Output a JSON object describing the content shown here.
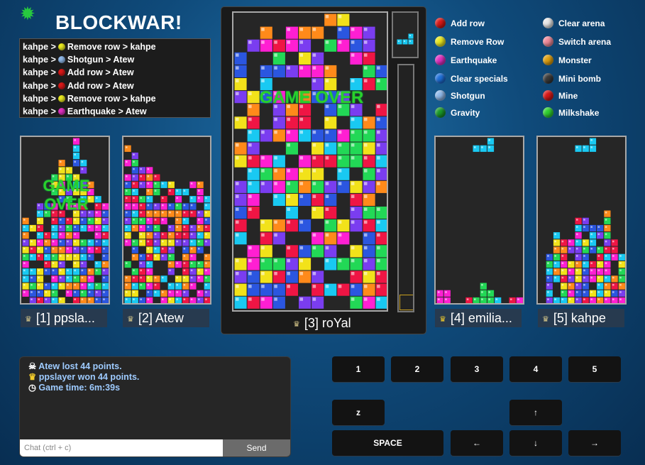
{
  "header": {
    "title": "BLOCKWAR!",
    "gear_icon": "gear-icon"
  },
  "event_log": [
    {
      "text_from": "kahpe >",
      "dot": "#e8e820",
      "text_rest": "Remove row > kahpe"
    },
    {
      "text_from": "kahpe >",
      "dot": "#8fb8e8",
      "text_rest": "Shotgun > Atew"
    },
    {
      "text_from": "kahpe >",
      "dot": "#d81818",
      "text_rest": "Add row > Atew"
    },
    {
      "text_from": "kahpe >",
      "dot": "#d81818",
      "text_rest": "Add row > Atew"
    },
    {
      "text_from": "kahpe >",
      "dot": "#e8e820",
      "text_rest": "Remove row > kahpe"
    },
    {
      "text_from": "kahpe >",
      "dot": "#e030c0",
      "text_rest": "Earthquake > Atew"
    }
  ],
  "players": [
    {
      "label": "[1] ppsla...",
      "game_over": true
    },
    {
      "label": "[2] Atew",
      "game_over": false
    },
    {
      "label": "[3] roYal",
      "game_over": true
    },
    {
      "label": "[4] emilia...",
      "game_over": false
    },
    {
      "label": "[5] kahpe",
      "game_over": false
    }
  ],
  "game_over_text": {
    "line1": "GAME",
    "line2": "OVER",
    "full": "GAME OVER"
  },
  "specials_legend": {
    "left": [
      {
        "label": "Add row",
        "color": "#d81818"
      },
      {
        "label": "Remove Row",
        "color": "#e8e820"
      },
      {
        "label": "Earthquake",
        "color": "#e030c0"
      },
      {
        "label": "Clear specials",
        "color": "#1e6fd8"
      },
      {
        "label": "Shotgun",
        "color": "#8fb8e8"
      },
      {
        "label": "Gravity",
        "color": "#1a9a2a"
      }
    ],
    "right": [
      {
        "label": "Clear arena",
        "color": "#e8e8e8"
      },
      {
        "label": "Switch arena",
        "color": "#f08a9a"
      },
      {
        "label": "Monster",
        "color": "#e0a010"
      },
      {
        "label": "Mini bomb",
        "color": "#3a3a3a"
      },
      {
        "label": "Mine",
        "color": "#d81818"
      },
      {
        "label": "Milkshake",
        "color": "#30d030"
      }
    ]
  },
  "chat": {
    "messages": [
      {
        "icon": "skull-icon",
        "glyph": "☠",
        "text": "Atew lost 44 points."
      },
      {
        "icon": "crown-icon",
        "glyph": "♛",
        "text": "ppslayer won 44 points."
      },
      {
        "icon": "clock-icon",
        "glyph": "◷",
        "text": "Game time: 6m:39s"
      }
    ],
    "placeholder": "Chat (ctrl + c)",
    "send_label": "Send"
  },
  "keys": {
    "k1": "1",
    "k2": "2",
    "k3": "3",
    "k4": "4",
    "k5": "5",
    "kz": "z",
    "kup": "↑",
    "kspace": "SPACE",
    "kleft": "←",
    "kdown": "↓",
    "kright": "→"
  },
  "colors": {
    "pink": "#ff1fd2",
    "cyan": "#19c9f2",
    "blue": "#2b56e0",
    "yellow": "#f2e21a",
    "orange": "#ff8a1a",
    "red": "#ef1544",
    "green": "#22d856",
    "purple": "#7a3df0"
  }
}
